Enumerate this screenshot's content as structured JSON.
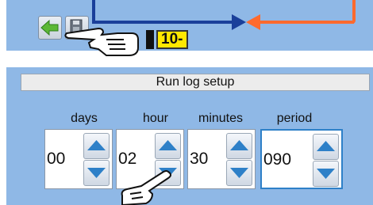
{
  "toolbar": {
    "back_icon": "green-arrow-left",
    "save_icon": "floppy-disk-hand",
    "step_label": "10-"
  },
  "run_log": {
    "title": "Run log setup",
    "fields": [
      {
        "label": "days",
        "value": "00"
      },
      {
        "label": "hour",
        "value": "02"
      },
      {
        "label": "minutes",
        "value": "30"
      },
      {
        "label": "period",
        "value": "090"
      }
    ]
  },
  "colors": {
    "panel_bg": "#8fb8e6",
    "pipe_blue": "#1a3f9a",
    "pipe_orange": "#ff6a2e",
    "arrow_blue": "#2e80c8",
    "step_badge": "#ffe800"
  }
}
